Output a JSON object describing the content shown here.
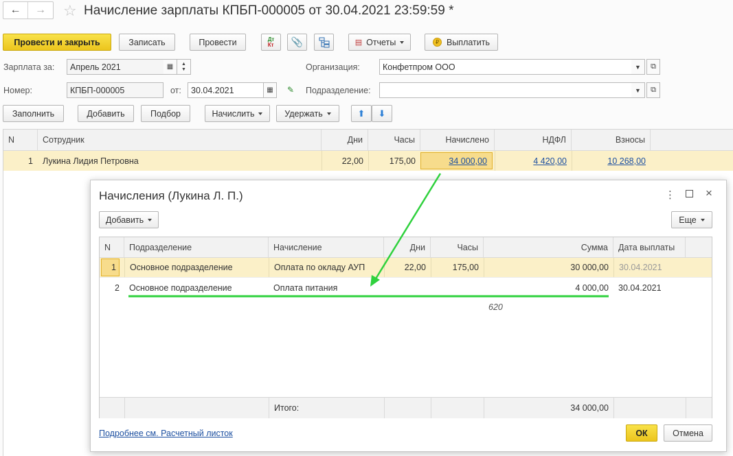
{
  "window": {
    "title": "Начисление зарплаты КПБП-000005 от 30.04.2021 23:59:59 *"
  },
  "toolbar": {
    "post_close": "Провести и закрыть",
    "save": "Записать",
    "post": "Провести",
    "reports": "Отчеты",
    "pay": "Выплатить"
  },
  "form": {
    "salary_for_label": "Зарплата за:",
    "salary_for_value": "Апрель 2021",
    "organization_label": "Организация:",
    "organization_value": "Конфетпром ООО",
    "number_label": "Номер:",
    "number_value": "КПБП-000005",
    "date_label": "от:",
    "date_value": "30.04.2021",
    "department_label": "Подразделение:",
    "department_value": ""
  },
  "actions": {
    "fill": "Заполнить",
    "add": "Добавить",
    "pick": "Подбор",
    "accrue": "Начислить",
    "withhold": "Удержать"
  },
  "main_table": {
    "columns": [
      "N",
      "Сотрудник",
      "Дни",
      "Часы",
      "Начислено",
      "НДФЛ",
      "Взносы"
    ],
    "rows": [
      {
        "n": "1",
        "employee": "Лукина Лидия Петровна",
        "days": "22,00",
        "hours": "175,00",
        "accrued": "34 000,00",
        "ndfl": "4 420,00",
        "contrib": "10 268,00"
      }
    ]
  },
  "dialog": {
    "title": "Начисления (Лукина Л. П.)",
    "add": "Добавить",
    "more": "Еще",
    "columns": [
      "N",
      "Подразделение",
      "Начисление",
      "Дни",
      "Часы",
      "Сумма",
      "Дата выплаты"
    ],
    "rows": [
      {
        "n": "1",
        "department": "Основное подразделение",
        "accrual": "Оплата по окладу АУП",
        "days": "22,00",
        "hours": "175,00",
        "sum": "30 000,00",
        "pay_date": "30.04.2021"
      },
      {
        "n": "2",
        "department": "Основное подразделение",
        "accrual": "Оплата питания",
        "days": "",
        "hours": "",
        "sum": "4 000,00",
        "pay_date": "30.04.2021"
      }
    ],
    "annotation": "620",
    "total_label": "Итого:",
    "total_sum": "34 000,00",
    "payslip_link": "Подробнее см. Расчетный листок",
    "ok": "ОК",
    "cancel": "Отмена"
  },
  "colors": {
    "accent_yellow": "#f0cf2a",
    "selected_row": "#fbf0c8",
    "link": "#1c4fa0",
    "arrow_green": "#2fd13d"
  }
}
